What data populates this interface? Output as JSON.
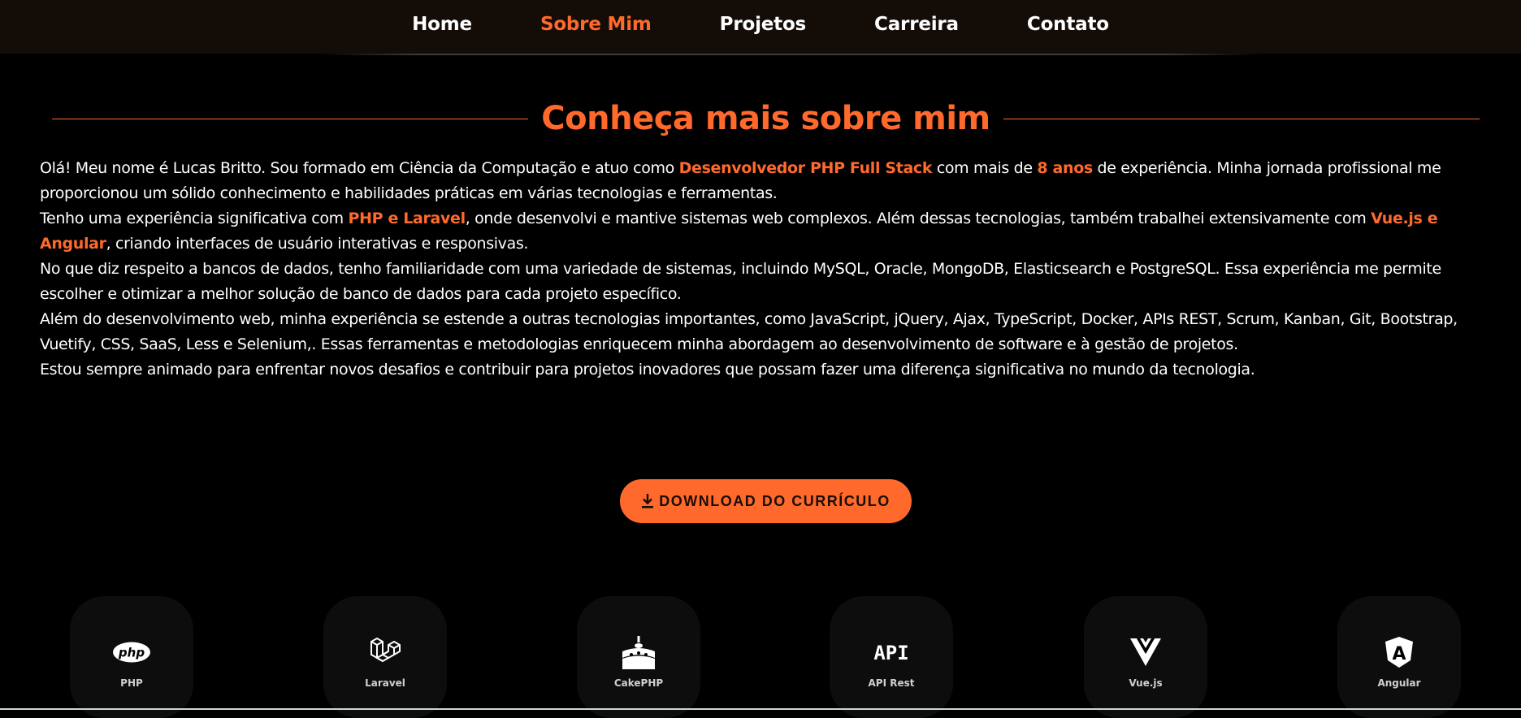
{
  "nav": {
    "items": [
      {
        "label": "Home",
        "active": false
      },
      {
        "label": "Sobre Mim",
        "active": true
      },
      {
        "label": "Projetos",
        "active": false
      },
      {
        "label": "Carreira",
        "active": false
      },
      {
        "label": "Contato",
        "active": false
      }
    ]
  },
  "about": {
    "title": "Conheça mais sobre mim",
    "p1_a": "Olá! Meu nome é Lucas Britto. Sou formado em Ciência da Computação e atuo como ",
    "p1_hl1": "Desenvolvedor PHP Full Stack",
    "p1_b": " com mais de ",
    "p1_hl2": "8 anos",
    "p1_c": " de experiência. Minha jornada profissional me proporcionou um sólido conhecimento e habilidades práticas em várias tecnologias e ferramentas.",
    "p2_a": "Tenho uma experiência significativa com ",
    "p2_hl1": "PHP e Laravel",
    "p2_b": ", onde desenvolvi e mantive sistemas web complexos. Além dessas tecnologias, também trabalhei extensivamente com ",
    "p2_hl2": "Vue.js e Angular",
    "p2_c": ", criando interfaces de usuário interativas e responsivas.",
    "p3": "No que diz respeito a bancos de dados, tenho familiaridade com uma variedade de sistemas, incluindo MySQL, Oracle, MongoDB, Elasticsearch e PostgreSQL. Essa experiência me permite escolher e otimizar a melhor solução de banco de dados para cada projeto específico.",
    "p4": "Além do desenvolvimento web, minha experiência se estende a outras tecnologias importantes, como JavaScript, jQuery, Ajax, TypeScript, Docker, APIs REST, Scrum, Kanban, Git, Bootstrap, Vuetify, CSS, SaaS, Less e Selenium,. Essas ferramentas e metodologias enriquecem minha abordagem ao desenvolvimento de software e à gestão de projetos.",
    "p5": "Estou sempre animado para enfrentar novos desafios e contribuir para projetos inovadores que possam fazer uma diferença significativa no mundo da tecnologia."
  },
  "download": {
    "label": "DOWNLOAD DO CURRÍCULO",
    "icon": "download-icon"
  },
  "skills": [
    {
      "label": "PHP",
      "icon": "php-icon",
      "logo_text": "php"
    },
    {
      "label": "Laravel",
      "icon": "laravel-icon"
    },
    {
      "label": "CakePHP",
      "icon": "cakephp-icon"
    },
    {
      "label": "API Rest",
      "icon": "api-icon",
      "logo_text": "API"
    },
    {
      "label": "Vue.js",
      "icon": "vuejs-icon"
    },
    {
      "label": "Angular",
      "icon": "angular-icon",
      "logo_text": "A"
    }
  ],
  "colors": {
    "accent": "#ff6a2c",
    "background": "#000000",
    "navbar": "#140c06"
  }
}
